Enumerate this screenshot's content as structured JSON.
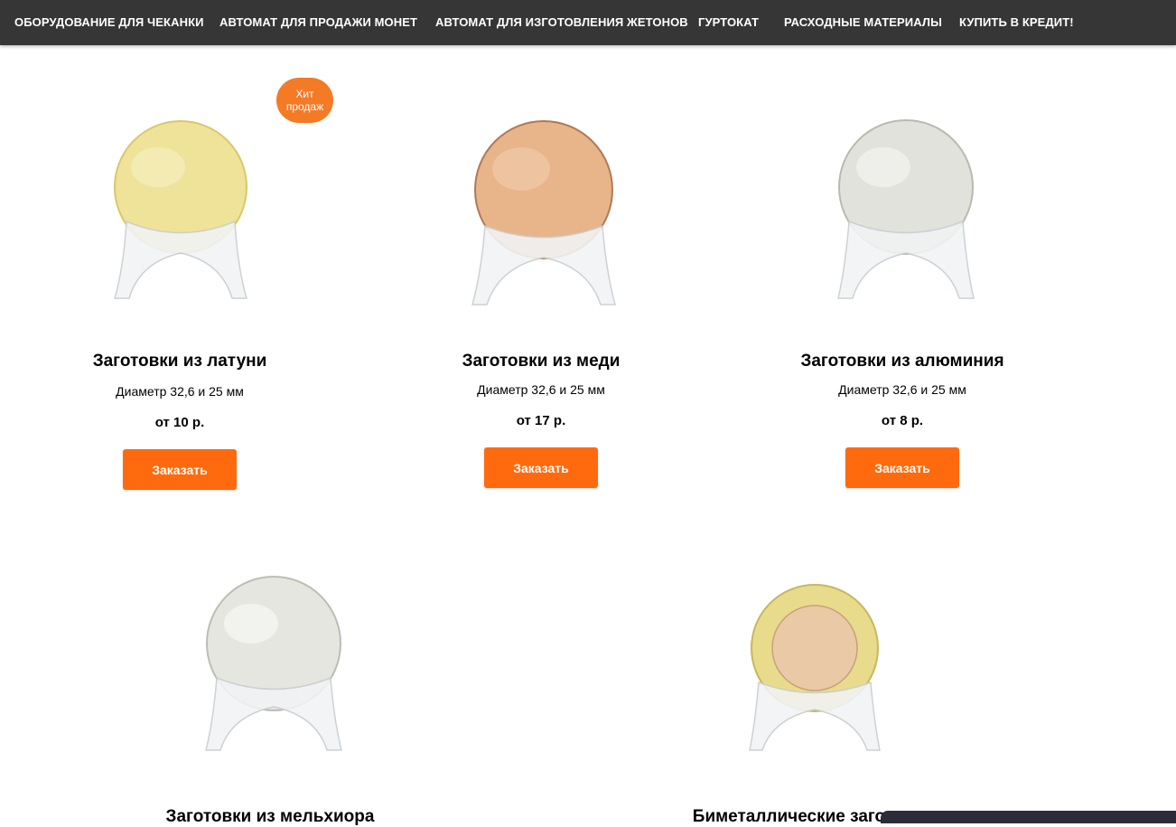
{
  "nav": {
    "items": [
      "ОБОРУДОВАНИЕ ДЛЯ ЧЕКАНКИ",
      "АВТОМАТ ДЛЯ ПРОДАЖИ МОНЕТ",
      "АВТОМАТ ДЛЯ ИЗГОТОВЛЕНИЯ ЖЕТОНОВ",
      "ГУРТОКАТ",
      "РАСХОДНЫЕ МАТЕРИАЛЫ",
      "КУПИТЬ В КРЕДИТ!"
    ]
  },
  "products": [
    {
      "title": "Заготовки из латуни",
      "desc": "Диаметр 32,6 и 25 мм",
      "price": "от 10 р.",
      "button": "Заказать",
      "badge": "Хит продаж",
      "coin_color": "#efe39a"
    },
    {
      "title": "Заготовки из меди",
      "desc": "Диаметр 32,6 и 25 мм",
      "price": "от 17 р.",
      "button": "Заказать",
      "coin_color": "#e8b48a"
    },
    {
      "title": "Заготовки из алюминия",
      "desc": "Диаметр 32,6 и 25 мм",
      "price": "от 8 р.",
      "button": "Заказать",
      "coin_color": "#e2e2dc"
    },
    {
      "title": "Заготовки из мельхиора",
      "coin_color": "#e6e6e1"
    },
    {
      "title": "Биметаллические заготовки",
      "coin_color": "#e9c9a6",
      "ring_color": "#e8dc8c"
    }
  ],
  "colors": {
    "nav_bg": "#363636",
    "accent": "#ff6a0f",
    "badge": "#f47a26"
  }
}
